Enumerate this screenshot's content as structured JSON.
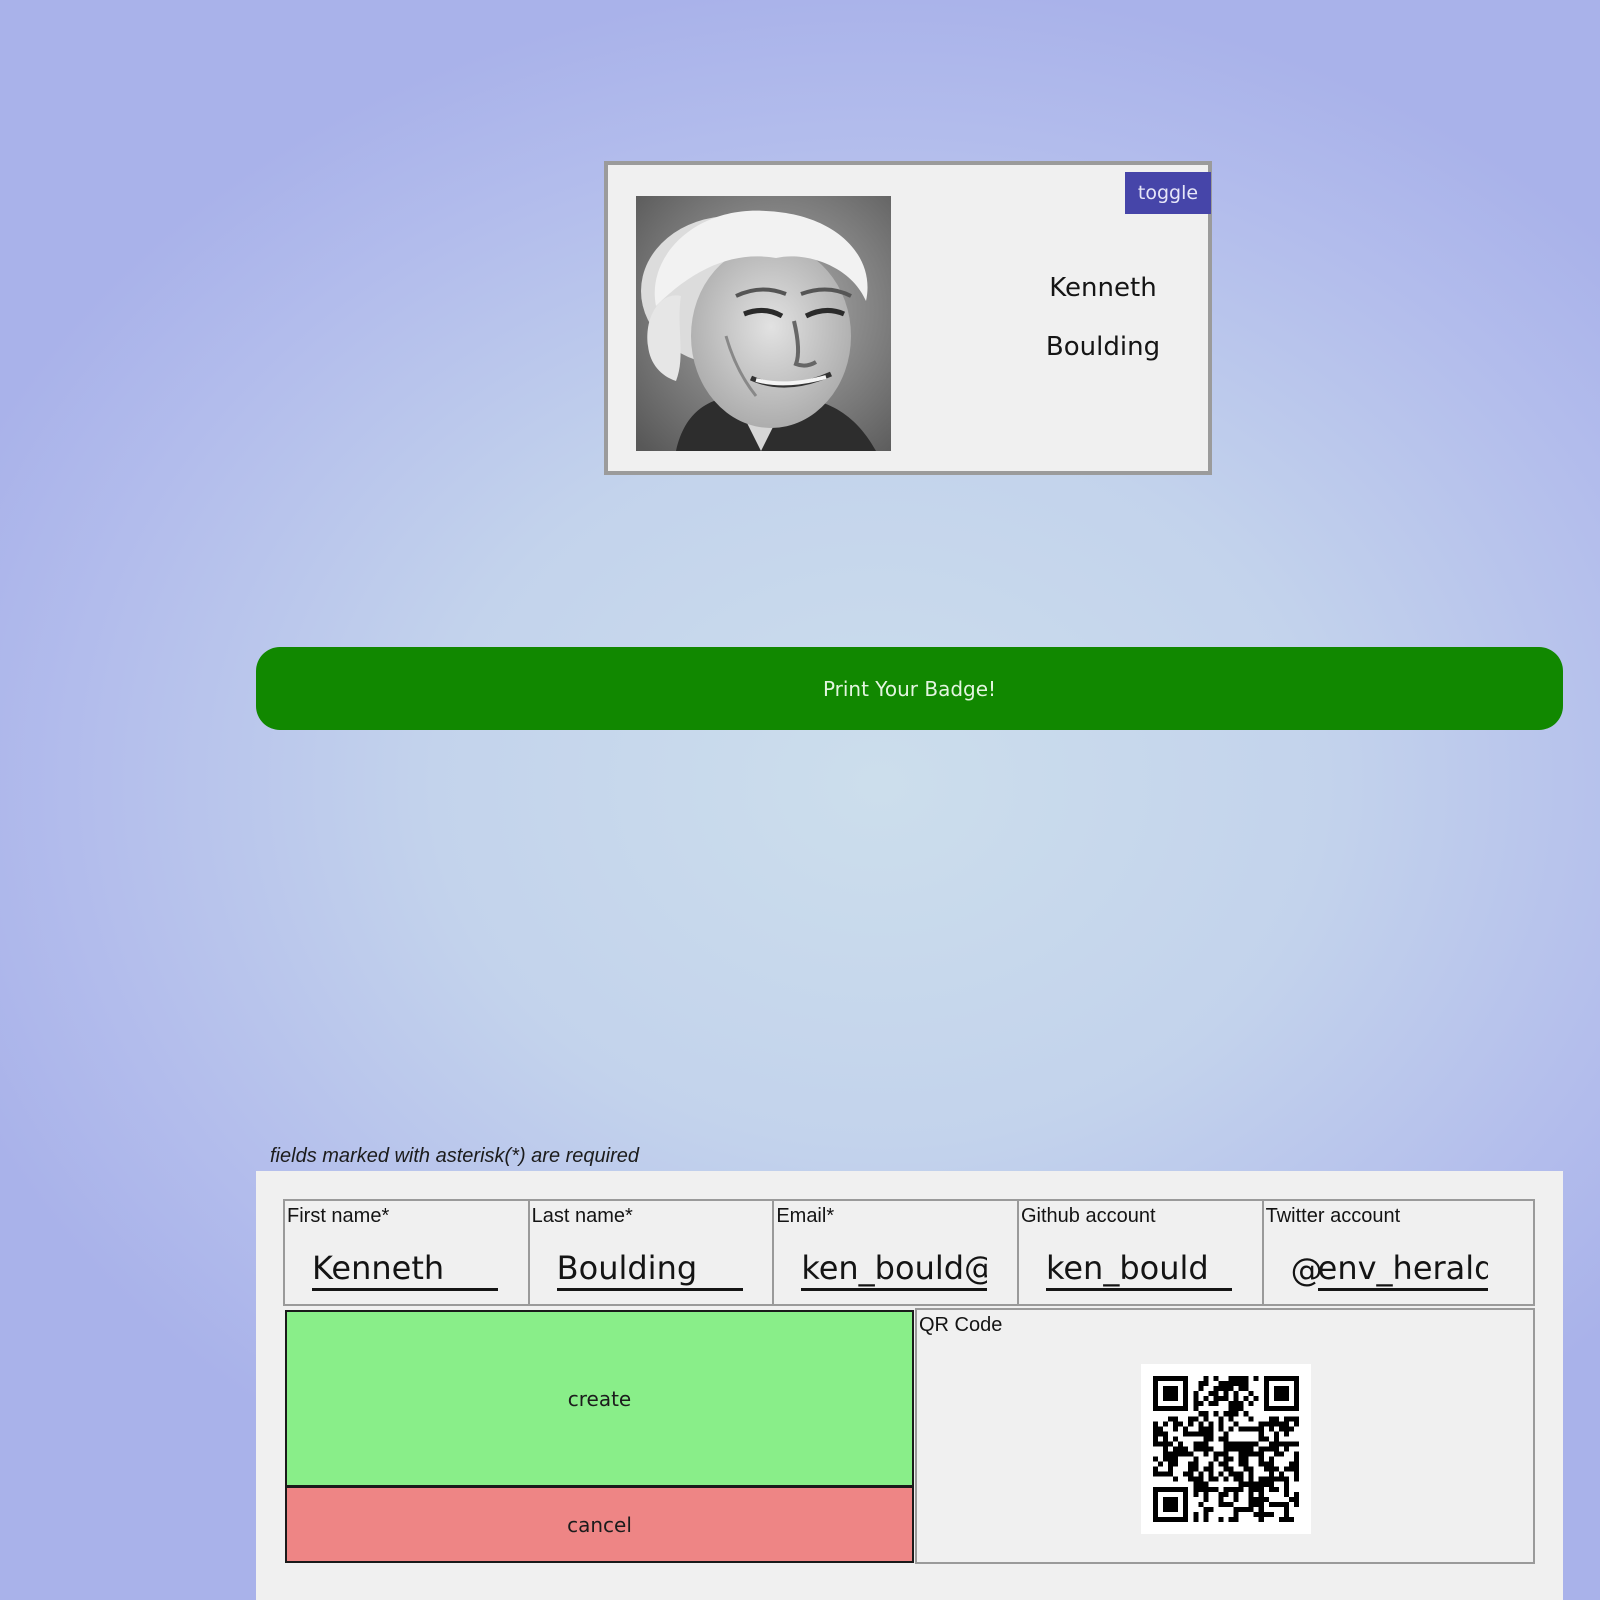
{
  "badge": {
    "toggle_label": "toggle",
    "first_name": "Kenneth",
    "last_name": "Boulding",
    "photo_alt": "profile-photo"
  },
  "print_button_label": "Print Your Badge!",
  "form": {
    "required_note": "fields marked with asterisk(*) are required",
    "fields": [
      {
        "label": "First name*",
        "value": "Kenneth"
      },
      {
        "label": "Last name*",
        "value": "Boulding"
      },
      {
        "label": "Email*",
        "value": "ken_bould@"
      },
      {
        "label": "Github account",
        "value": "ken_bould"
      },
      {
        "label": "Twitter account",
        "prefix": "@",
        "value": "env_herald"
      }
    ],
    "create_label": "create",
    "cancel_label": "cancel",
    "qr_label": "QR Code"
  },
  "colors": {
    "toggle_bg": "#4645a9",
    "print_bg": "#118800",
    "create_bg": "#89ee89",
    "cancel_bg": "#ee8585"
  }
}
